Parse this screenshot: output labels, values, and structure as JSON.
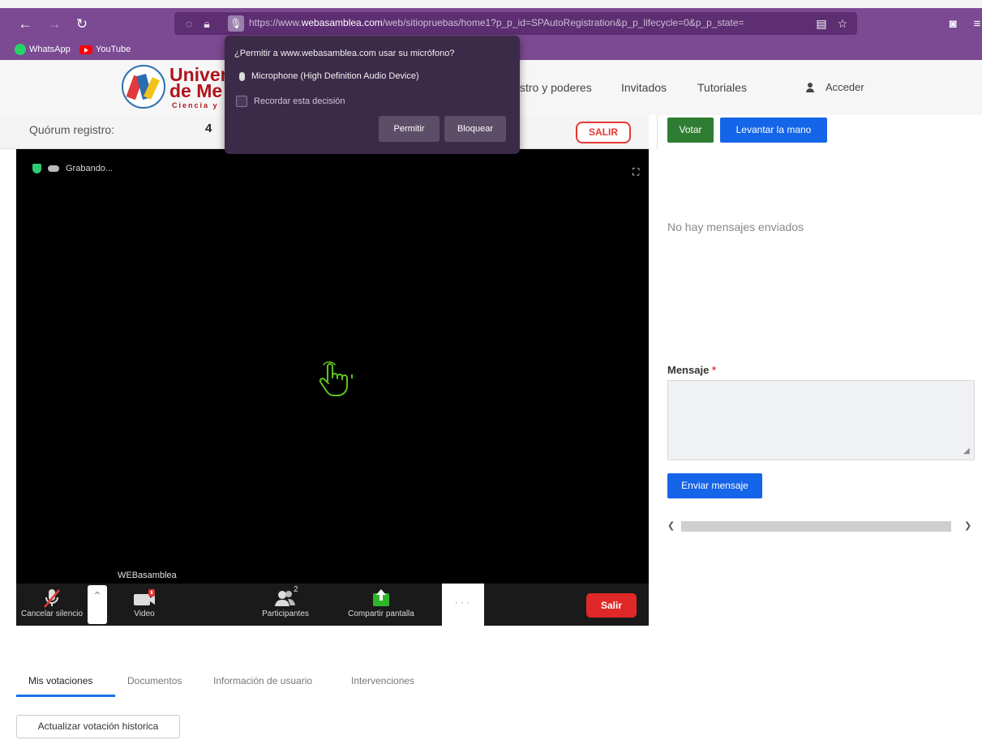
{
  "browser": {
    "url_prefix": "https://www.",
    "url_domain": "webasamblea.com",
    "url_rest": "/web/sitiopruebas/home1?p_p_id=SPAutoRegistration&p_p_lifecycle=0&p_p_state=",
    "bookmarks": [
      "WhatsApp",
      "YouTube"
    ],
    "accent_color": "#7b4a93"
  },
  "permission_popup": {
    "title": "¿Permitir a www.webasamblea.com usar su micrófono?",
    "device": "Microphone (High Definition Audio Device)",
    "remember_label": "Recordar esta decisión",
    "allow_label": "Permitir",
    "block_label": "Bloquear"
  },
  "site": {
    "logo_text_line1": "Univer",
    "logo_text_line2": "de Me",
    "logo_subtext": "Ciencia y",
    "menu": [
      "stro y poderes",
      "Invitados",
      "Tutoriales",
      "Acceder"
    ]
  },
  "quorum": {
    "label": "Quórum registro:",
    "value": "4",
    "exit_label": "SALIR"
  },
  "meeting": {
    "recording_label": "Grabando...",
    "speaker_name": "WEBasamblea",
    "controls": {
      "mute_label": "Cancelar silencio",
      "video_label": "Video",
      "participants_label": "Participantes",
      "participants_count": "2",
      "share_label": "Compartir pantalla",
      "more_label": "···",
      "leave_label": "Salir"
    }
  },
  "tabs": [
    "Mis votaciones",
    "Documentos",
    "Información de usuario",
    "Intervenciones"
  ],
  "history_button": "Actualizar votación historica",
  "chat": {
    "vote_label": "Votar",
    "raise_hand_label": "Levantar la mano",
    "empty_text": "No hay mensajes enviados",
    "message_label": "Mensaje",
    "required_mark": "*",
    "send_label": "Enviar mensaje"
  }
}
